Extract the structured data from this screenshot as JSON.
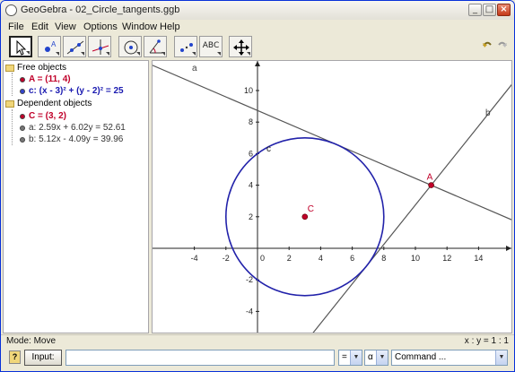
{
  "window": {
    "title": "GeoGebra - 02_Circle_tangents.ggb"
  },
  "menu": [
    "File",
    "Edit",
    "View",
    "Options",
    "Window",
    "Help"
  ],
  "toolbar": {
    "text_tool_label": "ABC"
  },
  "algebra": {
    "free_header": "Free objects",
    "free": [
      {
        "text": "A = (11, 4)",
        "color": "#c0002a"
      },
      {
        "text": "c: (x - 3)² + (y - 2)² = 25",
        "color": "#1a1ab0"
      }
    ],
    "dependent_header": "Dependent objects",
    "dependent": [
      {
        "text": "C = (3, 2)",
        "color": "#c0002a"
      },
      {
        "text": "a: 2.59x + 6.02y = 52.61",
        "color": "#333333"
      },
      {
        "text": "b: 5.12x - 4.09y = 39.96",
        "color": "#333333"
      }
    ]
  },
  "graphics": {
    "x_ticks": [
      -4,
      -2,
      2,
      4,
      6,
      8,
      10,
      12,
      14
    ],
    "y_ticks": [
      10,
      8,
      6,
      4,
      2,
      -2,
      -4
    ],
    "x_origin_label": "0",
    "labels": {
      "line_a": "a",
      "line_b": "b",
      "circle": "c",
      "point_A": "A",
      "point_C": "C"
    },
    "point_A": [
      11,
      4
    ],
    "point_C": [
      3,
      2
    ],
    "radius": 5,
    "colors": {
      "circle": "#2222aa",
      "point": "#c0002a",
      "line": "#555555"
    }
  },
  "status": {
    "mode": "Mode: Move",
    "ratio": "x : y = 1 : 1"
  },
  "inputbar": {
    "input_label": "Input:",
    "eq_combo": "=",
    "alpha_combo": "α",
    "command_placeholder": "Command ..."
  }
}
